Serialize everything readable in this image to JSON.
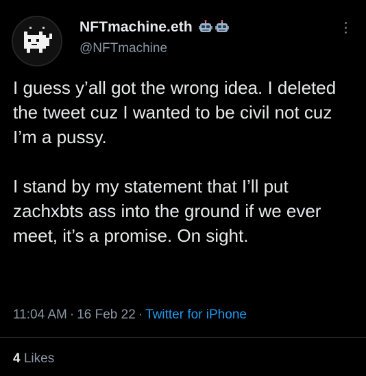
{
  "author": {
    "display_name": "NFTmachine.eth",
    "handle": "@NFTmachine",
    "avatar_icon": "pixel-cat-avatar",
    "name_emojis": [
      "robot-face-emoji",
      "robot-face-emoji"
    ]
  },
  "tweet": {
    "paragraphs": [
      "I guess y’all got the wrong idea.  I deleted the tweet cuz I wanted to be civil not cuz I’m a pussy.",
      "I stand by my statement that I’ll put zachxbts ass into the ground if we ever meet, it’s a promise. On sight."
    ],
    "time": "11:04 AM",
    "separator": "·",
    "date": "16 Feb 22",
    "source": "Twitter for iPhone"
  },
  "engagement": {
    "likes_count": "4",
    "likes_label": "Likes"
  },
  "colors": {
    "background": "#000000",
    "text": "#e7e9ea",
    "secondary_text": "#8b98a5",
    "link": "#1d9bf0",
    "divider": "#2f3336"
  },
  "icons": {
    "more": "more-dots-vertical-icon"
  }
}
